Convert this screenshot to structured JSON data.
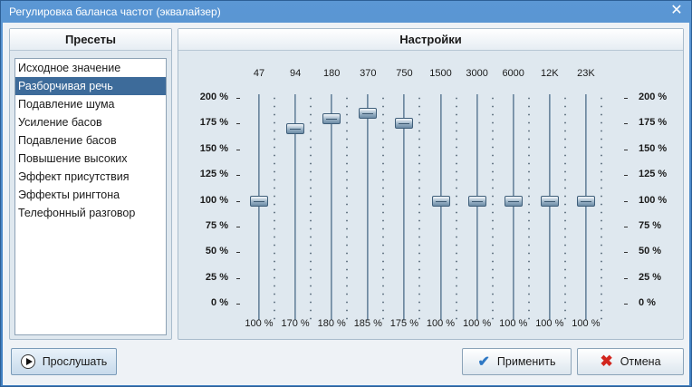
{
  "window": {
    "title": "Регулировка баланса частот (эквалайзер)"
  },
  "presets": {
    "header": "Пресеты",
    "items": [
      {
        "label": "Исходное значение",
        "selected": false
      },
      {
        "label": "Разборчивая речь",
        "selected": true
      },
      {
        "label": "Подавление шума",
        "selected": false
      },
      {
        "label": "Усиление басов",
        "selected": false
      },
      {
        "label": "Подавление басов",
        "selected": false
      },
      {
        "label": "Повышение высоких",
        "selected": false
      },
      {
        "label": "Эффект присутствия",
        "selected": false
      },
      {
        "label": "Эффекты рингтона",
        "selected": false
      },
      {
        "label": "Телефонный разговор",
        "selected": false
      }
    ]
  },
  "settings": {
    "header": "Настройки",
    "levels": [
      "200 %",
      "175 %",
      "150 %",
      "125 %",
      "100 %",
      "75 %",
      "50 %",
      "25 %",
      "0 %"
    ],
    "bands": [
      {
        "freq": "47",
        "value": 100,
        "label": "100 %"
      },
      {
        "freq": "94",
        "value": 170,
        "label": "170 %"
      },
      {
        "freq": "180",
        "value": 180,
        "label": "180 %"
      },
      {
        "freq": "370",
        "value": 185,
        "label": "185 %"
      },
      {
        "freq": "750",
        "value": 175,
        "label": "175 %"
      },
      {
        "freq": "1500",
        "value": 100,
        "label": "100 %"
      },
      {
        "freq": "3000",
        "value": 100,
        "label": "100 %"
      },
      {
        "freq": "6000",
        "value": 100,
        "label": "100 %"
      },
      {
        "freq": "12K",
        "value": 100,
        "label": "100 %"
      },
      {
        "freq": "23K",
        "value": 100,
        "label": "100 %"
      }
    ]
  },
  "buttons": {
    "play": "Прослушать",
    "apply": "Применить",
    "cancel": "Отмена"
  },
  "icons": {
    "play": "play-icon",
    "apply": "check-icon",
    "cancel": "cross-icon",
    "close": "close-icon"
  }
}
